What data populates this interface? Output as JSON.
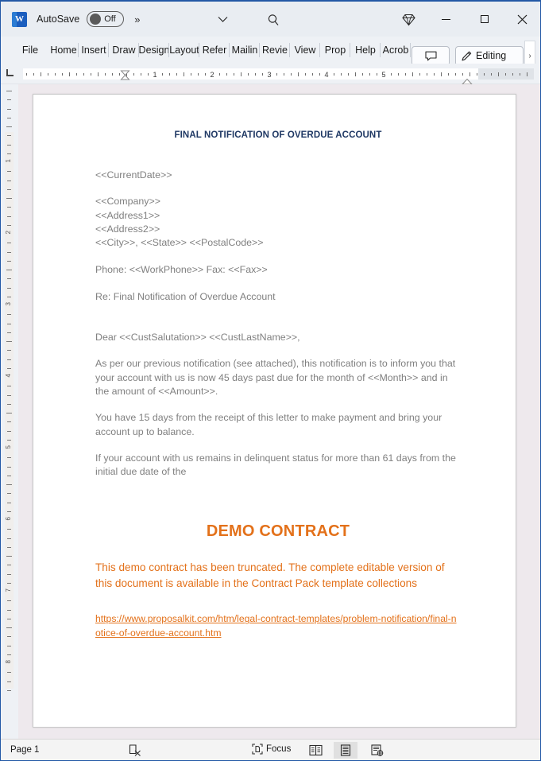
{
  "titlebar": {
    "app_icon": "word-logo",
    "app_letter": "W",
    "autosave_label": "AutoSave",
    "autosave_state": "Off",
    "overflow_label": "»",
    "chevron_icon": "chevron-down-icon",
    "search_icon": "search-icon",
    "gem_icon": "diamond-icon",
    "minimize_icon": "minimize-icon",
    "maximize_icon": "maximize-icon",
    "close_icon": "close-icon"
  },
  "ribbon": {
    "tabs": [
      {
        "label": "File",
        "name": "tab-file"
      },
      {
        "label": "Home",
        "name": "tab-home"
      },
      {
        "label": "Insert",
        "name": "tab-insert"
      },
      {
        "label": "Draw",
        "name": "tab-draw"
      },
      {
        "label": "Design",
        "name": "tab-design"
      },
      {
        "label": "Layout",
        "name": "tab-layout"
      },
      {
        "label": "Refer",
        "name": "tab-references"
      },
      {
        "label": "Mailin",
        "name": "tab-mailings"
      },
      {
        "label": "Revie",
        "name": "tab-review"
      },
      {
        "label": "View",
        "name": "tab-view"
      },
      {
        "label": "Prop",
        "name": "tab-proposal"
      },
      {
        "label": "Help",
        "name": "tab-help"
      },
      {
        "label": "Acrob",
        "name": "tab-acrobat"
      }
    ],
    "comment_icon": "comment-icon",
    "editing_label": "Editing",
    "editing_icon": "pencil-icon",
    "expand_arrow": "›"
  },
  "ruler": {
    "numbers": [
      1,
      2,
      3,
      4,
      5
    ],
    "left_tabstop_icon": "left-tab-stop-icon",
    "first_line_indent_icon": "first-line-indent-marker",
    "right_indent_icon": "right-indent-marker"
  },
  "vruler": {
    "numbers": [
      1,
      2,
      3,
      4,
      5,
      6,
      7,
      8
    ]
  },
  "document": {
    "title": "FINAL NOTIFICATION OF OVERDUE ACCOUNT",
    "blocks": [
      {
        "id": "date",
        "text": "<<CurrentDate>>"
      },
      {
        "id": "company",
        "text": "<<Company>>"
      },
      {
        "id": "address1",
        "text": "<<Address1>>"
      },
      {
        "id": "address2",
        "text": "<<Address2>>"
      },
      {
        "id": "citystate",
        "text": "<<City>>, <<State>>  <<PostalCode>>"
      },
      {
        "id": "phonefax",
        "text": "Phone: <<WorkPhone>>  Fax: <<Fax>>"
      },
      {
        "id": "re",
        "text": "Re:      Final Notification of Overdue Account"
      },
      {
        "id": "salutation",
        "text": "Dear <<CustSalutation>> <<CustLastName>>,"
      },
      {
        "id": "para1",
        "text": "As per our previous notification (see attached), this notification is to inform you that your account with us is now 45 days past due for the month of <<Month>> and in the amount of <<Amount>>."
      },
      {
        "id": "para2",
        "text": "You have 15 days from the receipt of this letter to make payment and bring your account up to balance."
      },
      {
        "id": "para3",
        "text": "If your account with us remains in delinquent status for more than 61 days from the initial due date of the"
      }
    ],
    "demo_heading": "DEMO CONTRACT",
    "demo_paragraph": "This demo contract has been truncated. The complete editable version of this document is available in the Contract Pack template collections",
    "demo_link": "https://www.proposalkit.com/htm/legal-contract-templates/problem-notification/final-notice-of-overdue-account.htm"
  },
  "statusbar": {
    "page_label": "Page 1",
    "proofing_icon": "proofing-errors-icon",
    "focus_label": "Focus",
    "focus_icon": "focus-mode-icon",
    "read_mode_icon": "read-mode-icon",
    "print_layout_icon": "print-layout-icon",
    "web_layout_icon": "web-layout-icon"
  },
  "colors": {
    "title_blue": "#1f3864",
    "demo_orange": "#e3711a",
    "body_gray": "#808080",
    "window_chrome": "#eef1f5",
    "canvas_bg": "#eee9ed",
    "accent_border": "#2258a6"
  }
}
